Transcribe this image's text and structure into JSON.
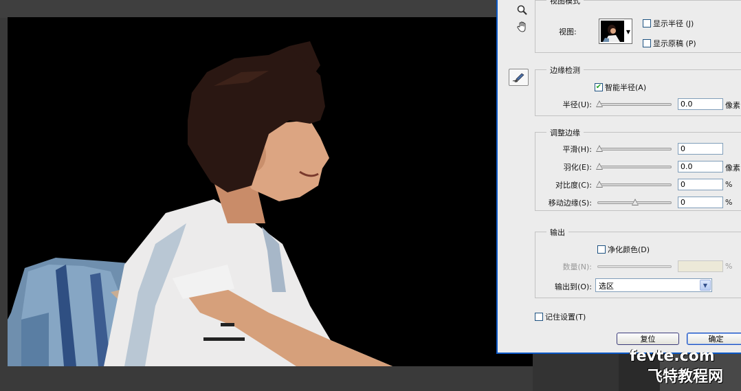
{
  "dialog": {
    "view_mode": {
      "title": "视图模式",
      "view_label": "视图:",
      "show_radius_label": "显示半径 (J)",
      "show_original_label": "显示原稿 (P)"
    },
    "edge_detection": {
      "title": "边缘检测",
      "smart_radius_label": "智能半径(A)",
      "smart_radius_checked": true,
      "radius_label": "半径(U):",
      "radius_value": "0.0",
      "radius_unit": "像素",
      "radius_level": 0
    },
    "adjust_edge": {
      "title": "调整边缘",
      "smooth_label": "平滑(H):",
      "smooth_value": "0",
      "smooth_level": 0,
      "feather_label": "羽化(E):",
      "feather_value": "0.0",
      "feather_unit": "像素",
      "feather_level": 0,
      "contrast_label": "对比度(C):",
      "contrast_value": "0",
      "contrast_unit": "%",
      "contrast_level": 0,
      "shift_label": "移动边缘(S):",
      "shift_value": "0",
      "shift_unit": "%",
      "shift_level": 0.5
    },
    "output": {
      "title": "输出",
      "decontaminate_label": "净化颜色(D)",
      "amount_label": "数量(N):",
      "amount_unit": "%",
      "output_to_label": "输出到(O):",
      "output_to_value": "选区"
    },
    "remember_label": "记住设置(T)",
    "reset_button": "复位",
    "ok_button": "确定"
  },
  "watermark": {
    "line1": "fevte.com",
    "line2": "飞特教程网"
  },
  "colors": {
    "dialog_bg": "#ececec",
    "dialog_border": "#0b58c6",
    "workspace": "#3a3a3a",
    "canvas_bg": "#000000"
  },
  "icons": [
    "zoom-icon",
    "hand-icon",
    "refine-radius-brush-icon"
  ]
}
